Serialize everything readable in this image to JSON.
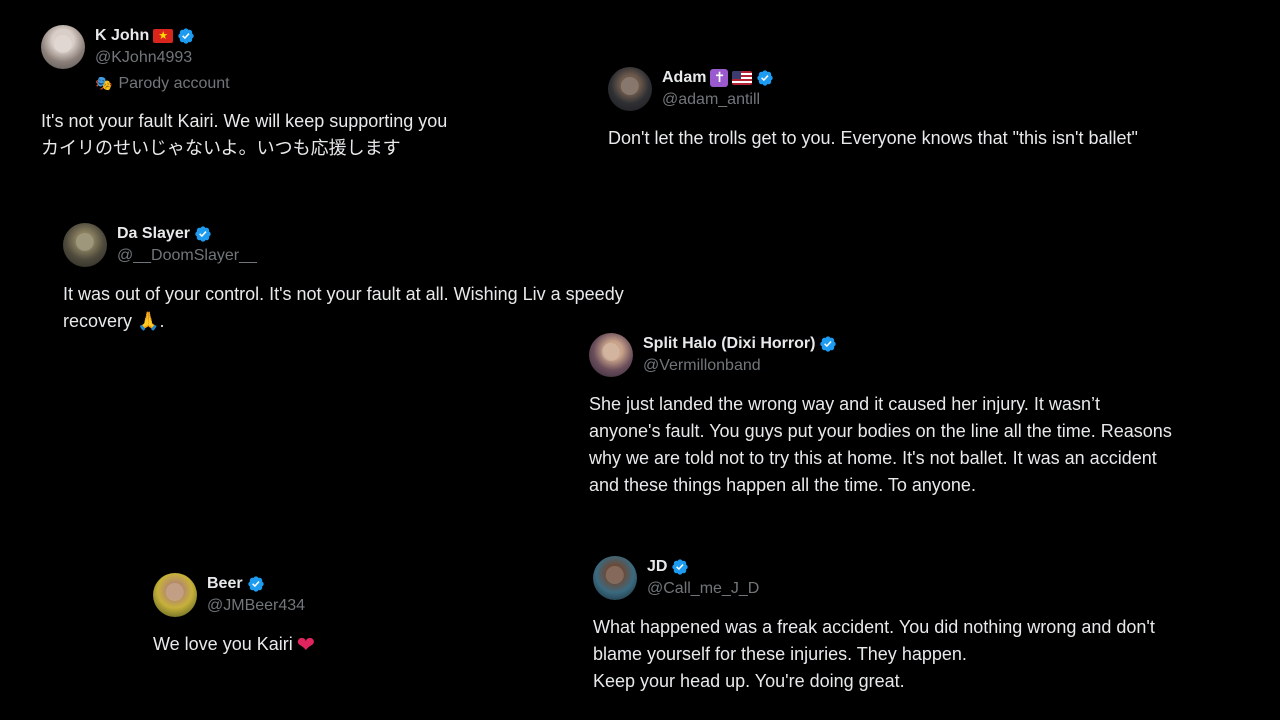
{
  "colors": {
    "background": "#000000",
    "text_primary": "#e7e9ea",
    "text_secondary": "#71767b",
    "verified_badge": "#1d9bf0"
  },
  "tweets": [
    {
      "name": "K John",
      "handle": "@KJohn4993",
      "badges": [
        "vietnam-flag-icon",
        "verified-icon"
      ],
      "label": "Parody account",
      "lines": [
        "It's not your fault Kairi. We will keep supporting you",
        "カイリのせいじゃないよ。いつも応援します"
      ]
    },
    {
      "name": "Adam",
      "handle": "@adam_antill",
      "badges": [
        "cross-icon",
        "us-flag-icon",
        "verified-icon"
      ],
      "lines": [
        "Don't let the trolls get to you. Everyone knows that \"this isn't ballet\""
      ]
    },
    {
      "name": "Da Slayer",
      "handle": "@__DoomSlayer__",
      "badges": [
        "verified-icon"
      ],
      "lines": [
        "It was out of your control. It's not your fault at all. Wishing Liv a speedy",
        "recovery"
      ],
      "trailing_emoji": "folded-hands-icon",
      "trailing_text": "."
    },
    {
      "name": "Split Halo (Dixi Horror)",
      "handle": "@Vermillonband",
      "badges": [
        "verified-icon"
      ],
      "lines": [
        "She just landed the wrong way and it caused her injury. It wasn’t",
        "anyone's fault. You guys put your bodies on the line all the time. Reasons",
        "why we are told not to try this at home. It's not ballet. It was an accident",
        "and these things happen all the time. To anyone."
      ]
    },
    {
      "name": "Beer",
      "handle": "@JMBeer434",
      "badges": [
        "verified-icon"
      ],
      "lines": [
        "We love you Kairi"
      ],
      "trailing_emoji": "red-heart-icon"
    },
    {
      "name": "JD",
      "handle": "@Call_me_J_D",
      "badges": [
        "verified-icon"
      ],
      "lines": [
        "What happened was a freak accident. You did nothing wrong and don't",
        "blame yourself for these injuries. They happen.",
        "Keep your head up. You're doing great."
      ]
    }
  ]
}
